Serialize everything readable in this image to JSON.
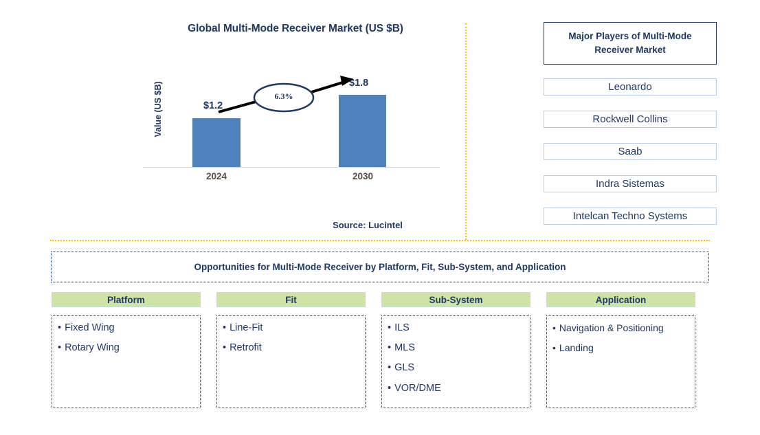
{
  "chart": {
    "title": "Global Multi-Mode Receiver Market (US $B)",
    "y_axis_label": "Value (US $B)",
    "cagr_label": "6.3%",
    "source": "Source: Lucintel"
  },
  "chart_data": {
    "type": "bar",
    "title": "Global Multi-Mode Receiver Market (US $B)",
    "categories": [
      "2024",
      "2030"
    ],
    "values": [
      1.2,
      1.8
    ],
    "data_labels": [
      "$1.2",
      "$1.8"
    ],
    "cagr": "6.3%",
    "xlabel": "",
    "ylabel": "Value (US $B)",
    "ylim": [
      0,
      2.05
    ],
    "grid": false,
    "legend": "none",
    "series_color": "#4F81BD",
    "annotations": [
      "6.3%"
    ]
  },
  "players": {
    "title": "Major Players of Multi-Mode Receiver Market",
    "items": [
      {
        "label": "Leonardo"
      },
      {
        "label": "Rockwell Collins"
      },
      {
        "label": "Saab"
      },
      {
        "label": "Indra Sistemas"
      },
      {
        "label": "Intelcan Techno Systems"
      }
    ]
  },
  "opportunities": {
    "banner": "Opportunities for Multi-Mode Receiver by Platform, Fit, Sub-System, and Application",
    "columns": [
      {
        "header": "Platform",
        "items": [
          "Fixed Wing",
          "Rotary Wing"
        ]
      },
      {
        "header": "Fit",
        "items": [
          "Line-Fit",
          "Retrofit"
        ]
      },
      {
        "header": "Sub-System",
        "items": [
          "ILS",
          "MLS",
          "GLS",
          "VOR/DME"
        ]
      },
      {
        "header": "Application",
        "items": [
          "Navigation & Positioning",
          "Landing"
        ]
      }
    ]
  },
  "colors": {
    "navy": "#1F3864",
    "bar_blue": "#4F81BD",
    "divider_orange": "#FFC000",
    "header_green": "#CFE3A7",
    "player_border": "#B8CCE4"
  }
}
